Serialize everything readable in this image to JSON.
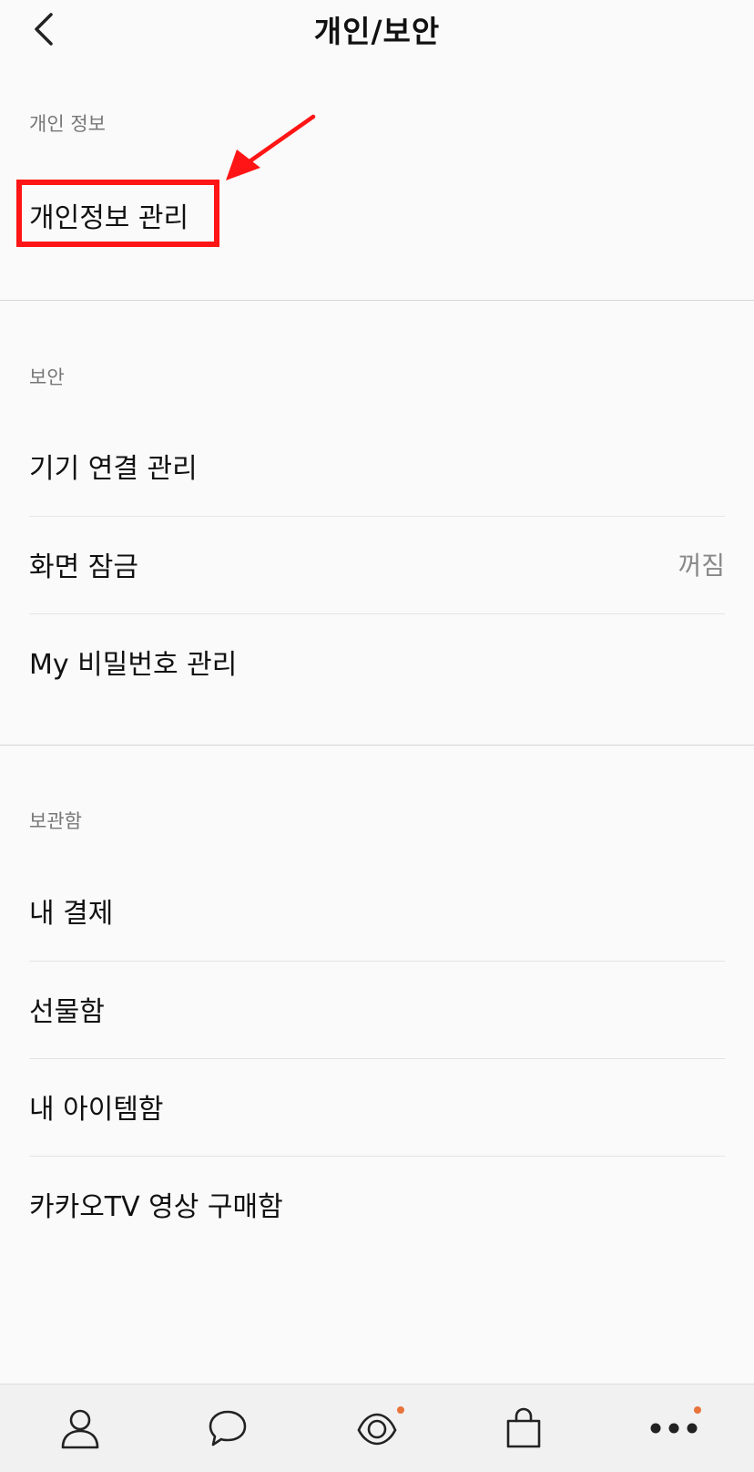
{
  "header": {
    "title": "개인/보안",
    "back_icon": "chevron-left-icon"
  },
  "sections": {
    "personal": {
      "label": "개인 정보",
      "items": [
        {
          "label": "개인정보 관리"
        }
      ]
    },
    "security": {
      "label": "보안",
      "items": [
        {
          "label": "기기 연결 관리"
        },
        {
          "label": "화면 잠금",
          "value": "꺼짐"
        },
        {
          "label": "My 비밀번호 관리"
        }
      ]
    },
    "storage": {
      "label": "보관함",
      "items": [
        {
          "label": "내 결제"
        },
        {
          "label": "선물함"
        },
        {
          "label": "내 아이템함"
        },
        {
          "label": "카카오TV 영상 구매함"
        }
      ]
    }
  },
  "tabbar": {
    "tabs": [
      {
        "icon": "person-icon"
      },
      {
        "icon": "chat-bubble-icon"
      },
      {
        "icon": "eye-view-icon",
        "has_badge": true
      },
      {
        "icon": "shopping-bag-icon"
      },
      {
        "icon": "more-dots-icon",
        "has_badge": true
      }
    ]
  },
  "colors": {
    "background": "#fafafa",
    "highlight": "#ff1515",
    "badge": "#e8743b",
    "muted_text": "#777777"
  }
}
